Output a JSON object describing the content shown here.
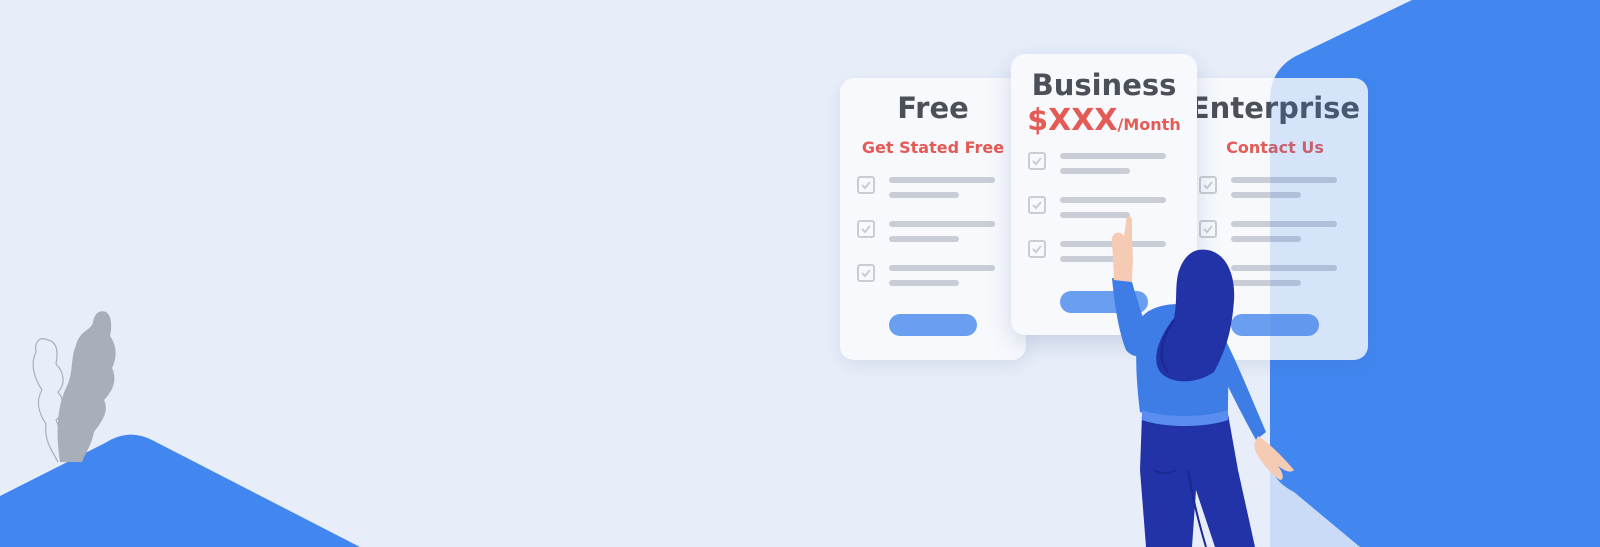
{
  "pricing": {
    "free": {
      "title": "Free",
      "subtitle": "Get Stated Free"
    },
    "business": {
      "title": "Business",
      "price_amount": "$XXX",
      "price_period": "/Month"
    },
    "enterprise": {
      "title": "Enterprise",
      "subtitle": "Contact Us"
    }
  },
  "colors": {
    "background": "#e8eef9",
    "accent_blue": "#4287f0",
    "button_blue": "#6a9ef0",
    "price_red": "#e45a55",
    "title_gray": "#4b4f57",
    "person_navy": "#2233a8"
  },
  "icons": [
    "checkbox-checked-icon",
    "plant-illustration",
    "person-illustration"
  ]
}
